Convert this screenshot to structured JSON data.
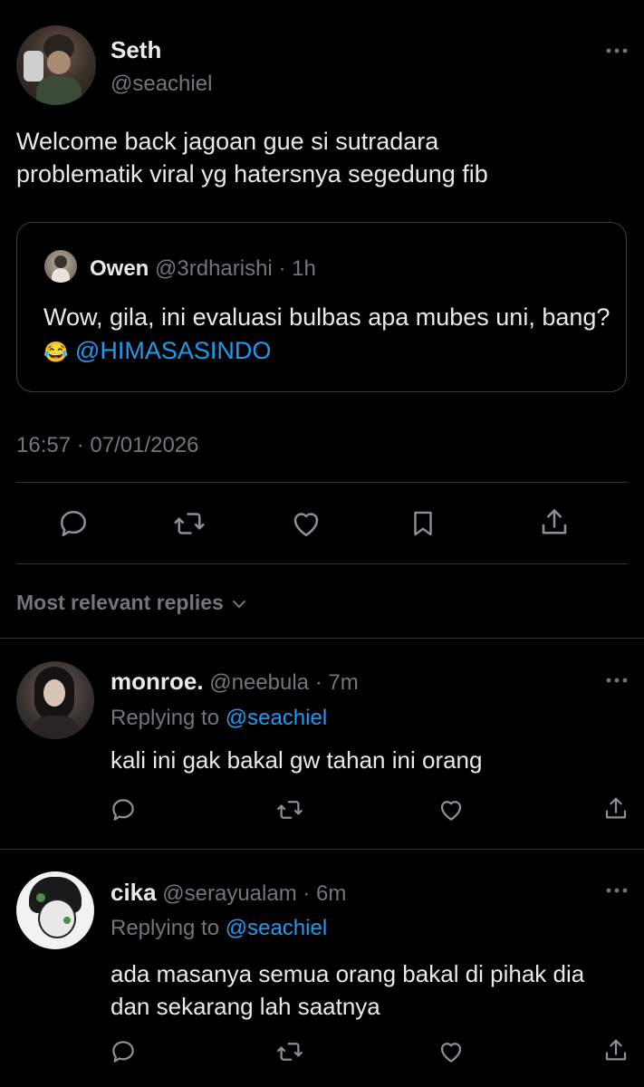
{
  "main_tweet": {
    "author_name": "Seth",
    "author_handle": "@seachiel",
    "text": "Welcome back jagoan gue si sutradara problematik viral yg hatersnya segedung fib",
    "timestamp": "16:57 · 07/01/2026",
    "more_icon": "more-horizontal-icon"
  },
  "quoted_tweet": {
    "author_name": "Owen",
    "author_handle": "@3rdharishi",
    "time_ago": "· 1h",
    "text": "Wow, gila, ini evaluasi bulbas apa mubes uni, bang?",
    "emoji": "😂",
    "mention": "@HIMASASINDO"
  },
  "actions": {
    "reply_icon": "reply-icon",
    "retweet_icon": "retweet-icon",
    "like_icon": "heart-icon",
    "bookmark_icon": "bookmark-icon",
    "share_icon": "share-icon"
  },
  "replies_filter": {
    "label": "Most relevant replies",
    "icon": "chevron-down-icon"
  },
  "replies": [
    {
      "author_name": "monroe.",
      "author_handle": "@neebula",
      "time_ago": "· 7m",
      "replying_prefix": "Replying to",
      "replying_to": "@seachiel",
      "text_lines": [
        "kali ini gak bakal gw tahan ini orang"
      ]
    },
    {
      "author_name": "cika",
      "author_handle": "@serayualam",
      "time_ago": "· 6m",
      "replying_prefix": "Replying to",
      "replying_to": "@seachiel",
      "text_lines": [
        "ada masanya semua orang bakal di pihak dia",
        "dan sekarang lah saatnya"
      ]
    }
  ],
  "colors": {
    "background": "#000000",
    "text": "#e7e9ea",
    "secondary": "#71767b",
    "accent": "#1d9bf0",
    "divider": "#2f3336"
  }
}
